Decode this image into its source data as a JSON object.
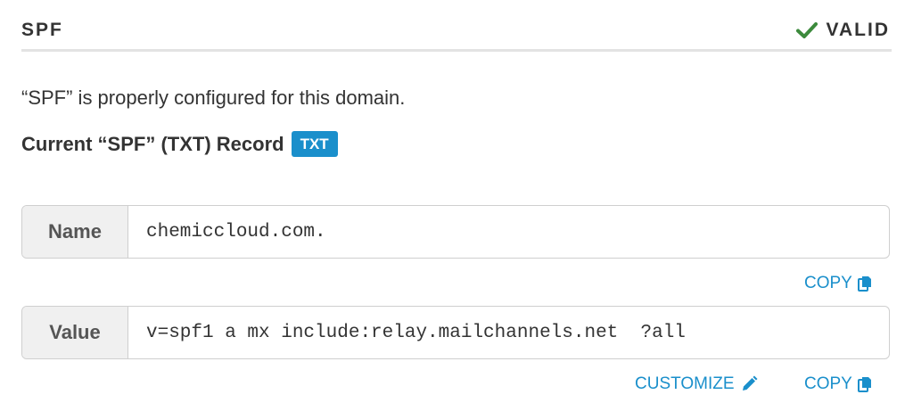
{
  "header": {
    "title": "SPF",
    "status_label": "VALID",
    "status_icon": "check-icon",
    "status_color": "#3c8a3c"
  },
  "description": "“SPF” is properly configured for this domain.",
  "record": {
    "title": "Current “SPF” (TXT) Record",
    "badge": "TXT",
    "badge_color": "#1a8fcb"
  },
  "fields": {
    "name": {
      "label": "Name",
      "value": "chemiccloud.com."
    },
    "value": {
      "label": "Value",
      "value": "v=spf1 a mx include:relay.mailchannels.net  ?all"
    }
  },
  "actions": {
    "copy_label": "COPY",
    "customize_label": "CUSTOMIZE",
    "copy_icon": "copy-icon",
    "customize_icon": "pencil-icon",
    "link_color": "#1a8fcb"
  }
}
